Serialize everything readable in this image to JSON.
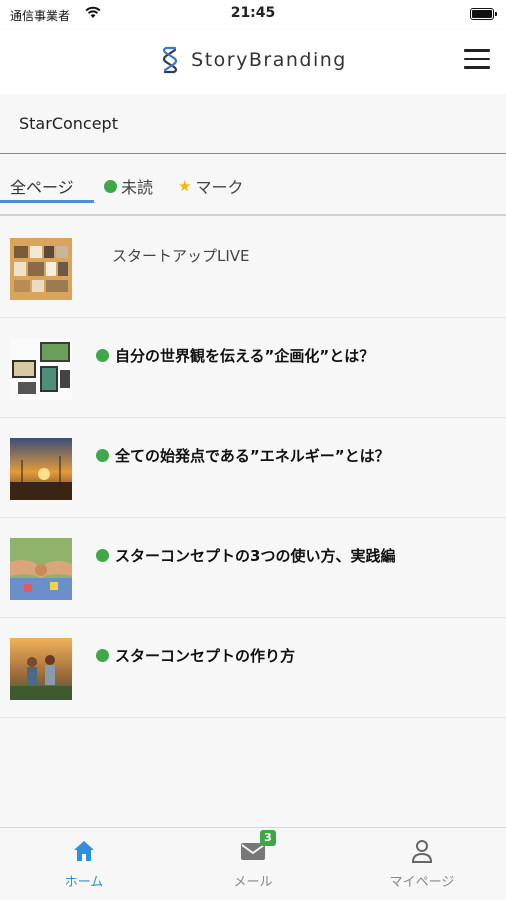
{
  "status_bar": {
    "carrier": "通信事業者",
    "time": "21:45"
  },
  "header": {
    "brand_name": "StoryBranding",
    "logo_icon": "story-branding-logo",
    "menu_icon": "hamburger-menu-icon"
  },
  "concept": {
    "title": "StarConcept"
  },
  "tabs": [
    {
      "label": "全ページ",
      "active": true
    },
    {
      "label": "未読",
      "icon": "green-dot-icon"
    },
    {
      "label": "マーク",
      "icon": "star-icon"
    }
  ],
  "items": [
    {
      "title": "スタートアップLIVE",
      "unread": false,
      "thumb": "collage-thumbnail"
    },
    {
      "title": "自分の世界観を伝える”企画化”とは？",
      "unread": true,
      "thumb": "devices-thumbnail"
    },
    {
      "title": "全ての始発点である”エネルギー”とは？",
      "unread": true,
      "thumb": "sunset-thumbnail"
    },
    {
      "title": "スターコンセプトの3つの使い方、実践編",
      "unread": true,
      "thumb": "hands-thumbnail"
    },
    {
      "title": "スターコンセプトの作り方",
      "unread": true,
      "thumb": "children-thumbnail"
    }
  ],
  "tabbar": [
    {
      "label": "ホーム",
      "icon": "home-icon",
      "active": true
    },
    {
      "label": "メール",
      "icon": "mail-icon",
      "badge": "3"
    },
    {
      "label": "マイページ",
      "icon": "person-icon"
    }
  ],
  "colors": {
    "accent": "#2f8fde",
    "unread_dot": "#3fa64a",
    "star": "#f5b800",
    "tab_indicator": "#4a90d9"
  }
}
